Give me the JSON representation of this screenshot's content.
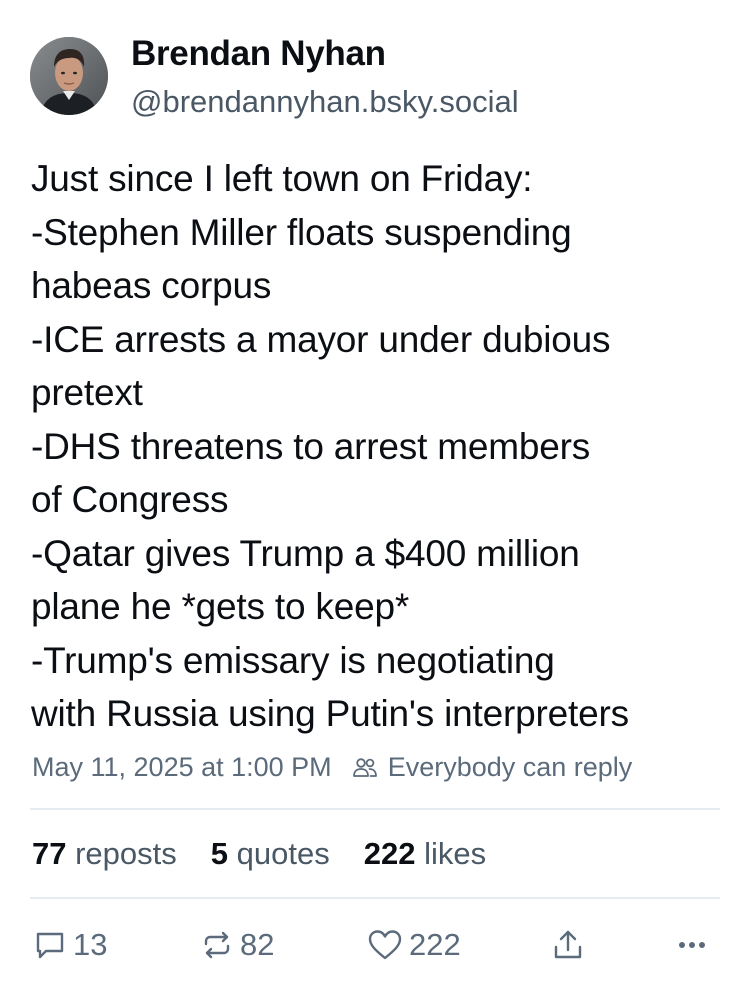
{
  "author": {
    "name": "Brendan Nyhan",
    "handle": "@brendannyhan.bsky.social"
  },
  "post": {
    "lines": [
      "Just since I left town on Friday:",
      "-Stephen Miller floats suspending",
      "habeas corpus",
      "-ICE arrests a mayor under dubious",
      "pretext",
      "-DHS threatens to arrest members",
      "of Congress",
      "-Qatar gives Trump a $400 million",
      "plane he *gets to keep*",
      "-Trump's emissary is negotiating",
      "with Russia using Putin's interpreters"
    ],
    "timestamp": "May 11, 2025 at 1:00 PM",
    "reply_setting": "Everybody can reply"
  },
  "stats": {
    "reposts": {
      "count": "77",
      "label": "reposts"
    },
    "quotes": {
      "count": "5",
      "label": "quotes"
    },
    "likes": {
      "count": "222",
      "label": "likes"
    }
  },
  "actions": {
    "reply_count": "13",
    "repost_count": "82",
    "like_count": "222"
  },
  "icons": {
    "reply": "speech-bubble-icon",
    "repost": "repost-arrows-icon",
    "like": "heart-icon",
    "share": "share-icon",
    "more": "more-dots-icon",
    "audience": "people-icon"
  },
  "colors": {
    "text_primary": "#0b0f14",
    "text_secondary": "#4a5866",
    "icon_gray": "#5b6b7b",
    "divider": "#e6ebef"
  }
}
